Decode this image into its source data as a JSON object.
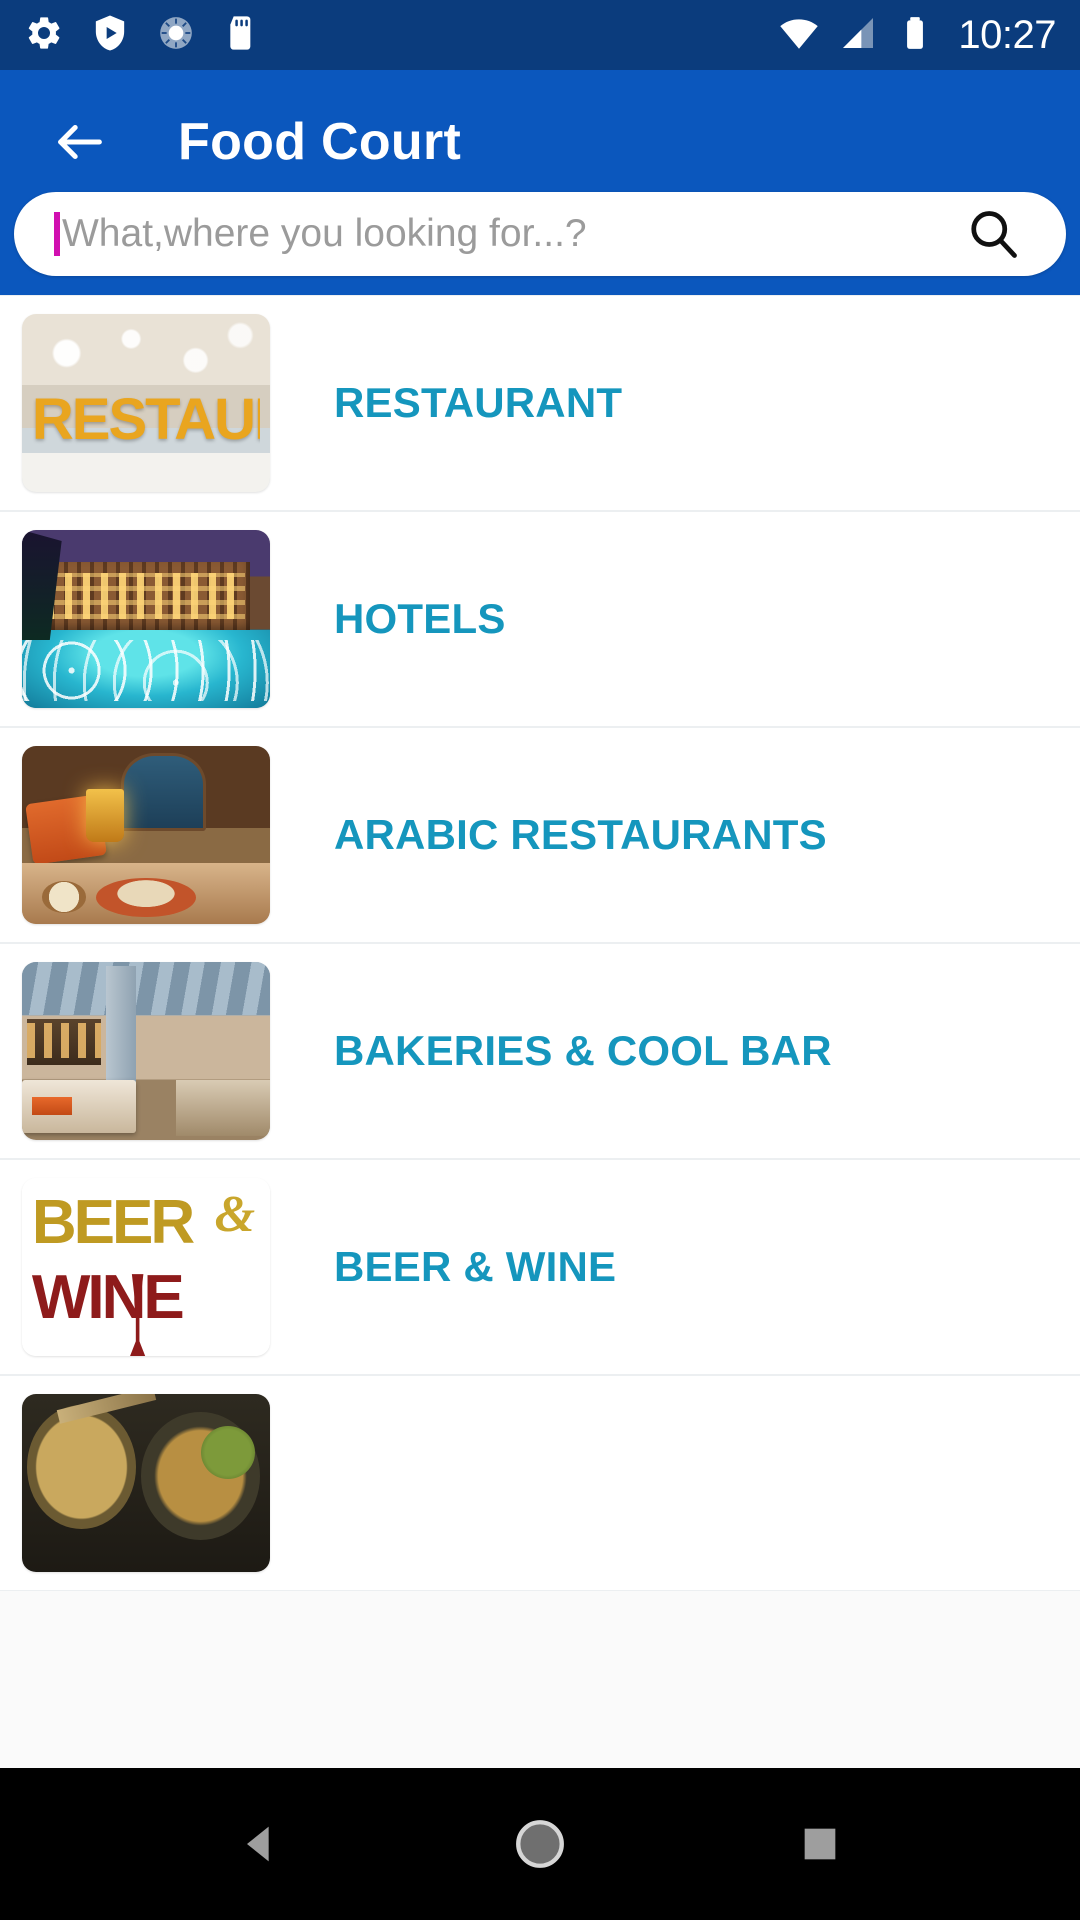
{
  "status_bar": {
    "background": "#0b3c7d",
    "time": "10:27",
    "left_icons": [
      {
        "name": "settings-gear-icon",
        "label": "Settings"
      },
      {
        "name": "shield-play-icon",
        "label": "Protected media"
      },
      {
        "name": "sync-spinner-icon",
        "label": "Syncing"
      },
      {
        "name": "sd-card-icon",
        "label": "SD card"
      }
    ],
    "right_icons": [
      {
        "name": "wifi-icon",
        "label": "Wi-Fi full"
      },
      {
        "name": "cellular-signal-icon",
        "label": "Mobile signal"
      },
      {
        "name": "battery-icon",
        "label": "Battery full"
      }
    ]
  },
  "app_bar": {
    "background": "#0b57bd",
    "title": "Food Court",
    "back_label": "Back"
  },
  "search": {
    "placeholder": "What,where you looking for...?",
    "value": "",
    "caret_color": "#d10fb0",
    "icon": "search-icon"
  },
  "list": {
    "accent_color": "#1596bd",
    "items": [
      {
        "label": "RESTAURANT",
        "thumb": "restaurant-interior-photo",
        "thumb_colors": [
          "#d8cfc0",
          "#f0e6d2",
          "#e8b93c"
        ]
      },
      {
        "label": "HOTELS",
        "thumb": "hotel-pool-night-photo",
        "thumb_colors": [
          "#2a1f3d",
          "#7b4a2a",
          "#2ec4d6"
        ]
      },
      {
        "label": "ARABIC RESTAURANTS",
        "thumb": "arabic-dining-room-photo",
        "thumb_colors": [
          "#3a2416",
          "#c97b45",
          "#e0782f"
        ]
      },
      {
        "label": "BAKERIES & COOL BAR",
        "thumb": "bakery-counter-photo",
        "thumb_colors": [
          "#8fa4b4",
          "#d8c0a8",
          "#6e5a46"
        ]
      },
      {
        "label": "BEER & WINE",
        "thumb": "beer-and-wine-logo",
        "thumb_colors": [
          "#ffffff",
          "#c5a227",
          "#8e1b1b"
        ]
      },
      {
        "label": "",
        "thumb": "noodle-bowls-photo",
        "thumb_colors": [
          "#2b2b22",
          "#b99a4e",
          "#7b8c3a"
        ]
      }
    ]
  },
  "nav_bar": {
    "background": "#000000",
    "buttons": [
      {
        "name": "nav-back-button",
        "label": "Back"
      },
      {
        "name": "nav-home-button",
        "label": "Home"
      },
      {
        "name": "nav-recents-button",
        "label": "Recents"
      }
    ]
  }
}
